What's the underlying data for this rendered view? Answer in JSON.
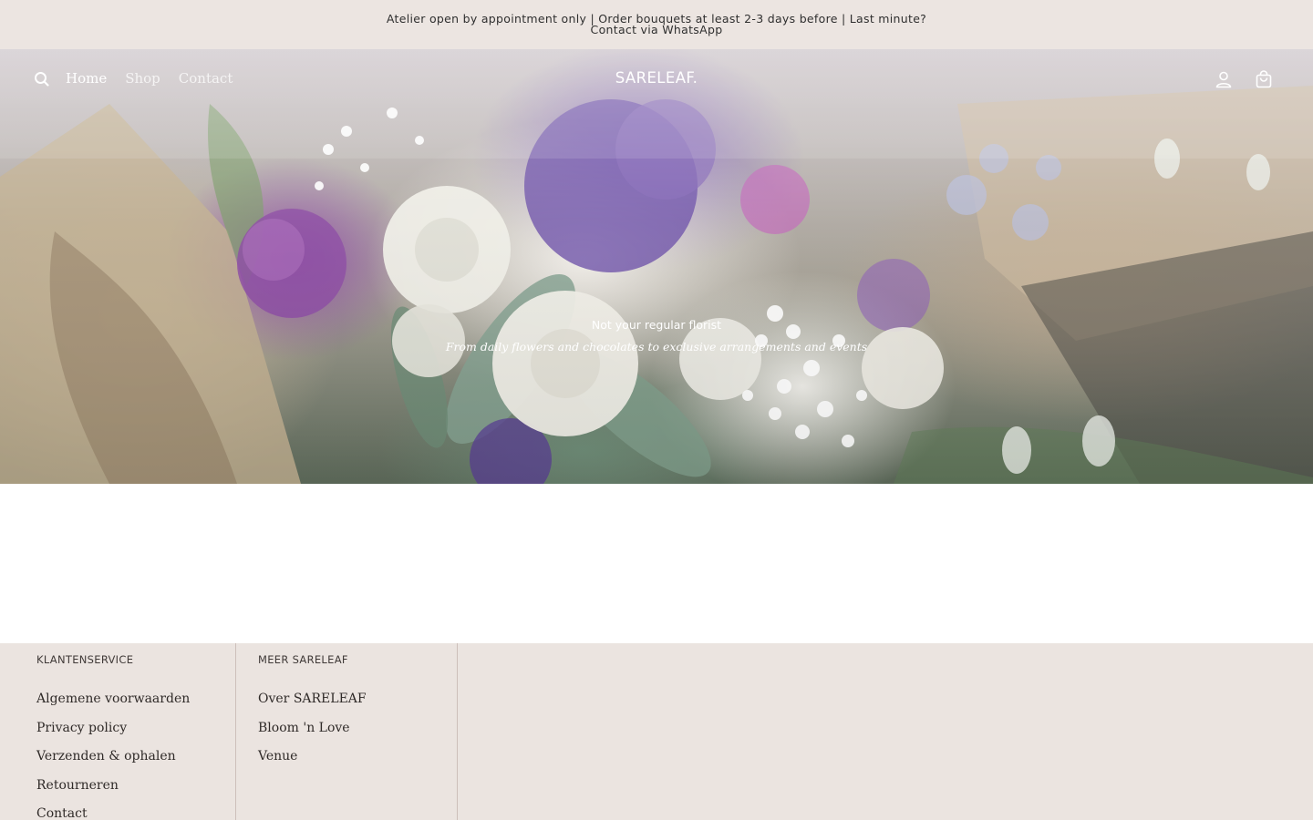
{
  "announcement": {
    "text": "Atelier open by appointment only | Order bouquets at least 2-3 days before | Last minute? Contact via WhatsApp"
  },
  "header": {
    "logo": "SARELEAF.",
    "nav": [
      {
        "label": "Home",
        "active": true
      },
      {
        "label": "Shop",
        "active": false
      },
      {
        "label": "Contact",
        "active": false
      }
    ],
    "icons": {
      "search": "search-icon",
      "account": "account-icon",
      "cart": "shopping-bag-icon"
    }
  },
  "hero": {
    "heading": "Not your regular florist",
    "subheading": "From daily flowers and chocolates to exclusive arrangements and events"
  },
  "footer": {
    "columns": [
      {
        "heading": "KLANTENSERVICE",
        "links": [
          "Algemene voorwaarden",
          "Privacy policy",
          "Verzenden & ophalen",
          "Retourneren",
          "Contact"
        ]
      },
      {
        "heading": "MEER SARELEAF",
        "links": [
          "Over SARELEAF",
          "Bloom 'n Love",
          "Venue"
        ]
      }
    ]
  },
  "colors": {
    "announcement_bg": "#ece5e1",
    "footer_bg": "#ebe4e0",
    "divider": "#cdbfba"
  }
}
